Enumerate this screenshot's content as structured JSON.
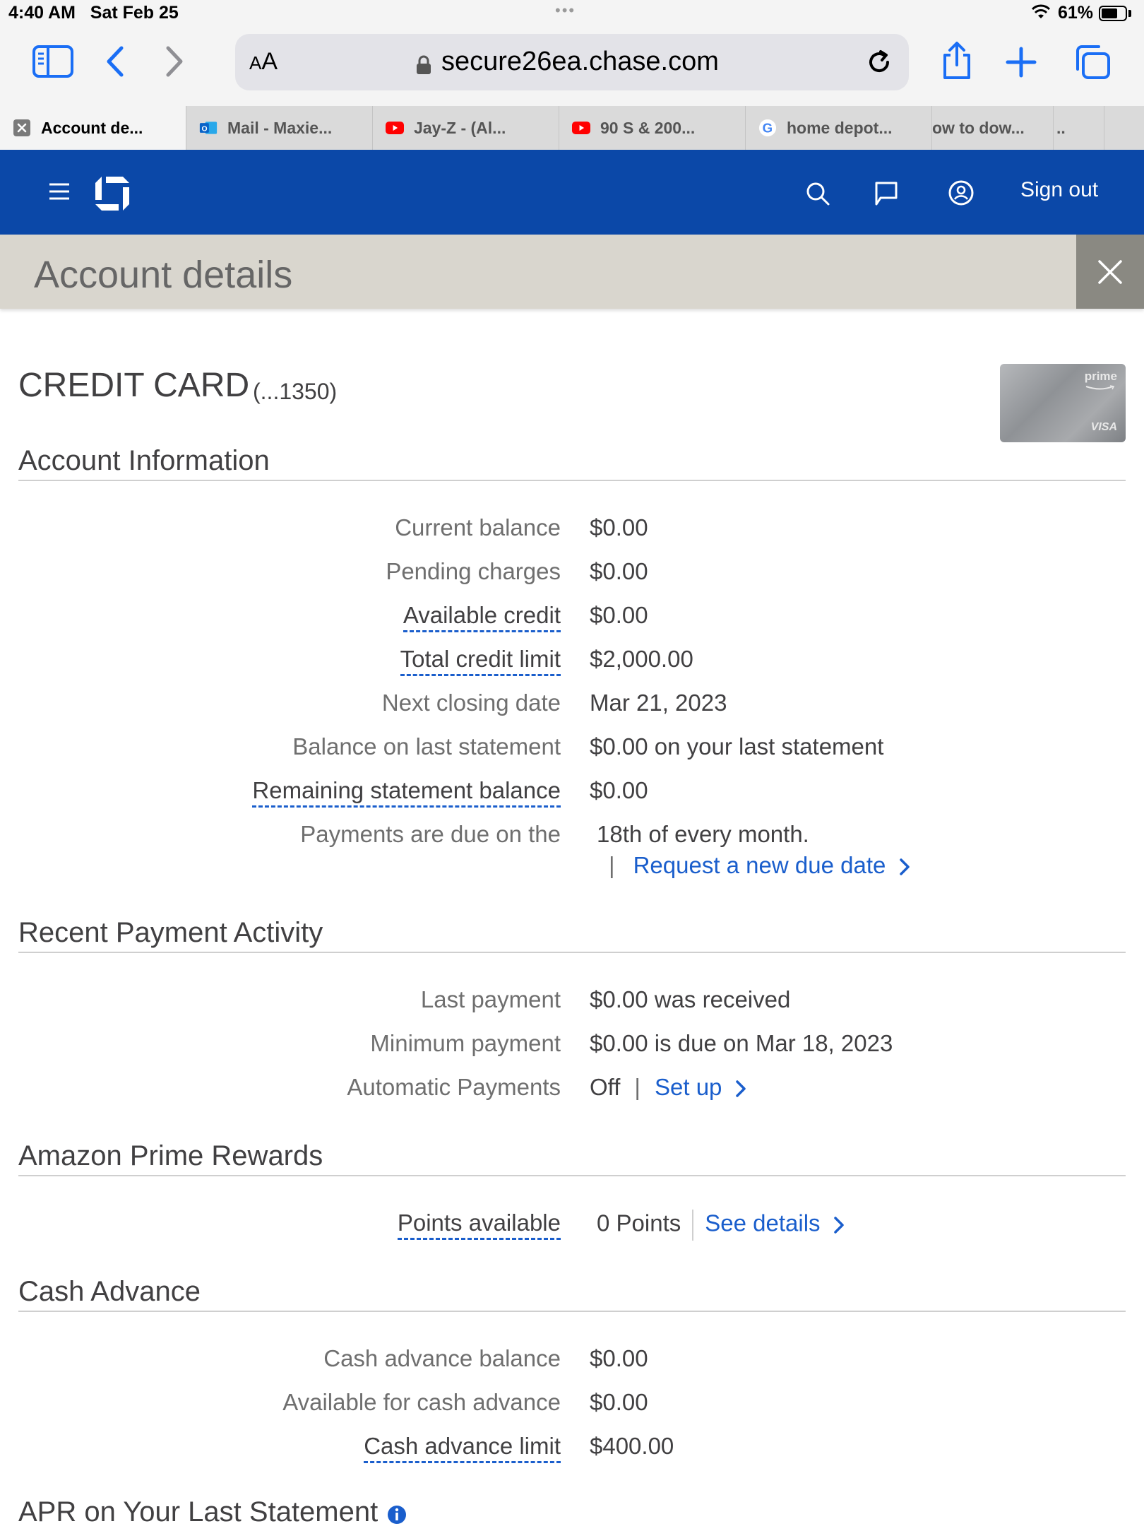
{
  "status": {
    "time": "4:40 AM",
    "date": "Sat Feb 25",
    "battery": "61%"
  },
  "browser": {
    "aa": "AA",
    "url": "secure26ea.chase.com"
  },
  "tabs": [
    {
      "label": "Account de...",
      "icon": "close-icon"
    },
    {
      "label": "Mail - Maxie...",
      "icon": "outlook-icon"
    },
    {
      "label": "Jay-Z - (Al...",
      "icon": "youtube-icon"
    },
    {
      "label": "90 S & 200...",
      "icon": "youtube-icon"
    },
    {
      "label": "home depot...",
      "icon": "google-icon"
    },
    {
      "label": "ow to dow...",
      "icon": ""
    },
    {
      "label": "..",
      "icon": ""
    }
  ],
  "header": {
    "signout": "Sign out"
  },
  "page": {
    "title": "Account details"
  },
  "card": {
    "type": "CREDIT CARD",
    "number": "(...1350)",
    "brand_top": "prime",
    "brand_bottom": "VISA"
  },
  "account_info": {
    "heading": "Account Information",
    "rows": [
      {
        "label": "Current balance",
        "value": "$0.00"
      },
      {
        "label": "Pending charges",
        "value": "$0.00"
      },
      {
        "label": "Available credit",
        "value": "$0.00"
      },
      {
        "label": "Total credit limit",
        "value": "$2,000.00"
      },
      {
        "label": "Next closing date",
        "value": "Mar 21, 2023"
      },
      {
        "label": "Balance on last statement",
        "value": "$0.00 on your last statement"
      },
      {
        "label": "Remaining statement balance",
        "value": "$0.00"
      },
      {
        "label": "Payments are due on the",
        "value": "18th of every month."
      }
    ],
    "due_date_link": "Request a new due date"
  },
  "payment_activity": {
    "heading": "Recent Payment Activity",
    "rows": [
      {
        "label": "Last payment",
        "value": "$0.00 was received"
      },
      {
        "label": "Minimum payment",
        "value": "$0.00 is due on Mar 18, 2023"
      },
      {
        "label": "Automatic Payments",
        "value": "Off"
      }
    ],
    "setup_link": "Set up"
  },
  "rewards": {
    "heading": "Amazon Prime Rewards",
    "label": "Points available",
    "value": "0 Points",
    "link": "See details"
  },
  "cash_advance": {
    "heading": "Cash Advance",
    "rows": [
      {
        "label": "Cash advance balance",
        "value": "$0.00"
      },
      {
        "label": "Available for cash advance",
        "value": "$0.00"
      },
      {
        "label": "Cash advance limit",
        "value": "$400.00"
      }
    ]
  },
  "apr": {
    "heading": "APR on Your Last Statement"
  },
  "colors": {
    "chase_blue": "#0b48a8",
    "link_blue": "#1a5ecc",
    "detail_bar": "#d9d6ce"
  }
}
